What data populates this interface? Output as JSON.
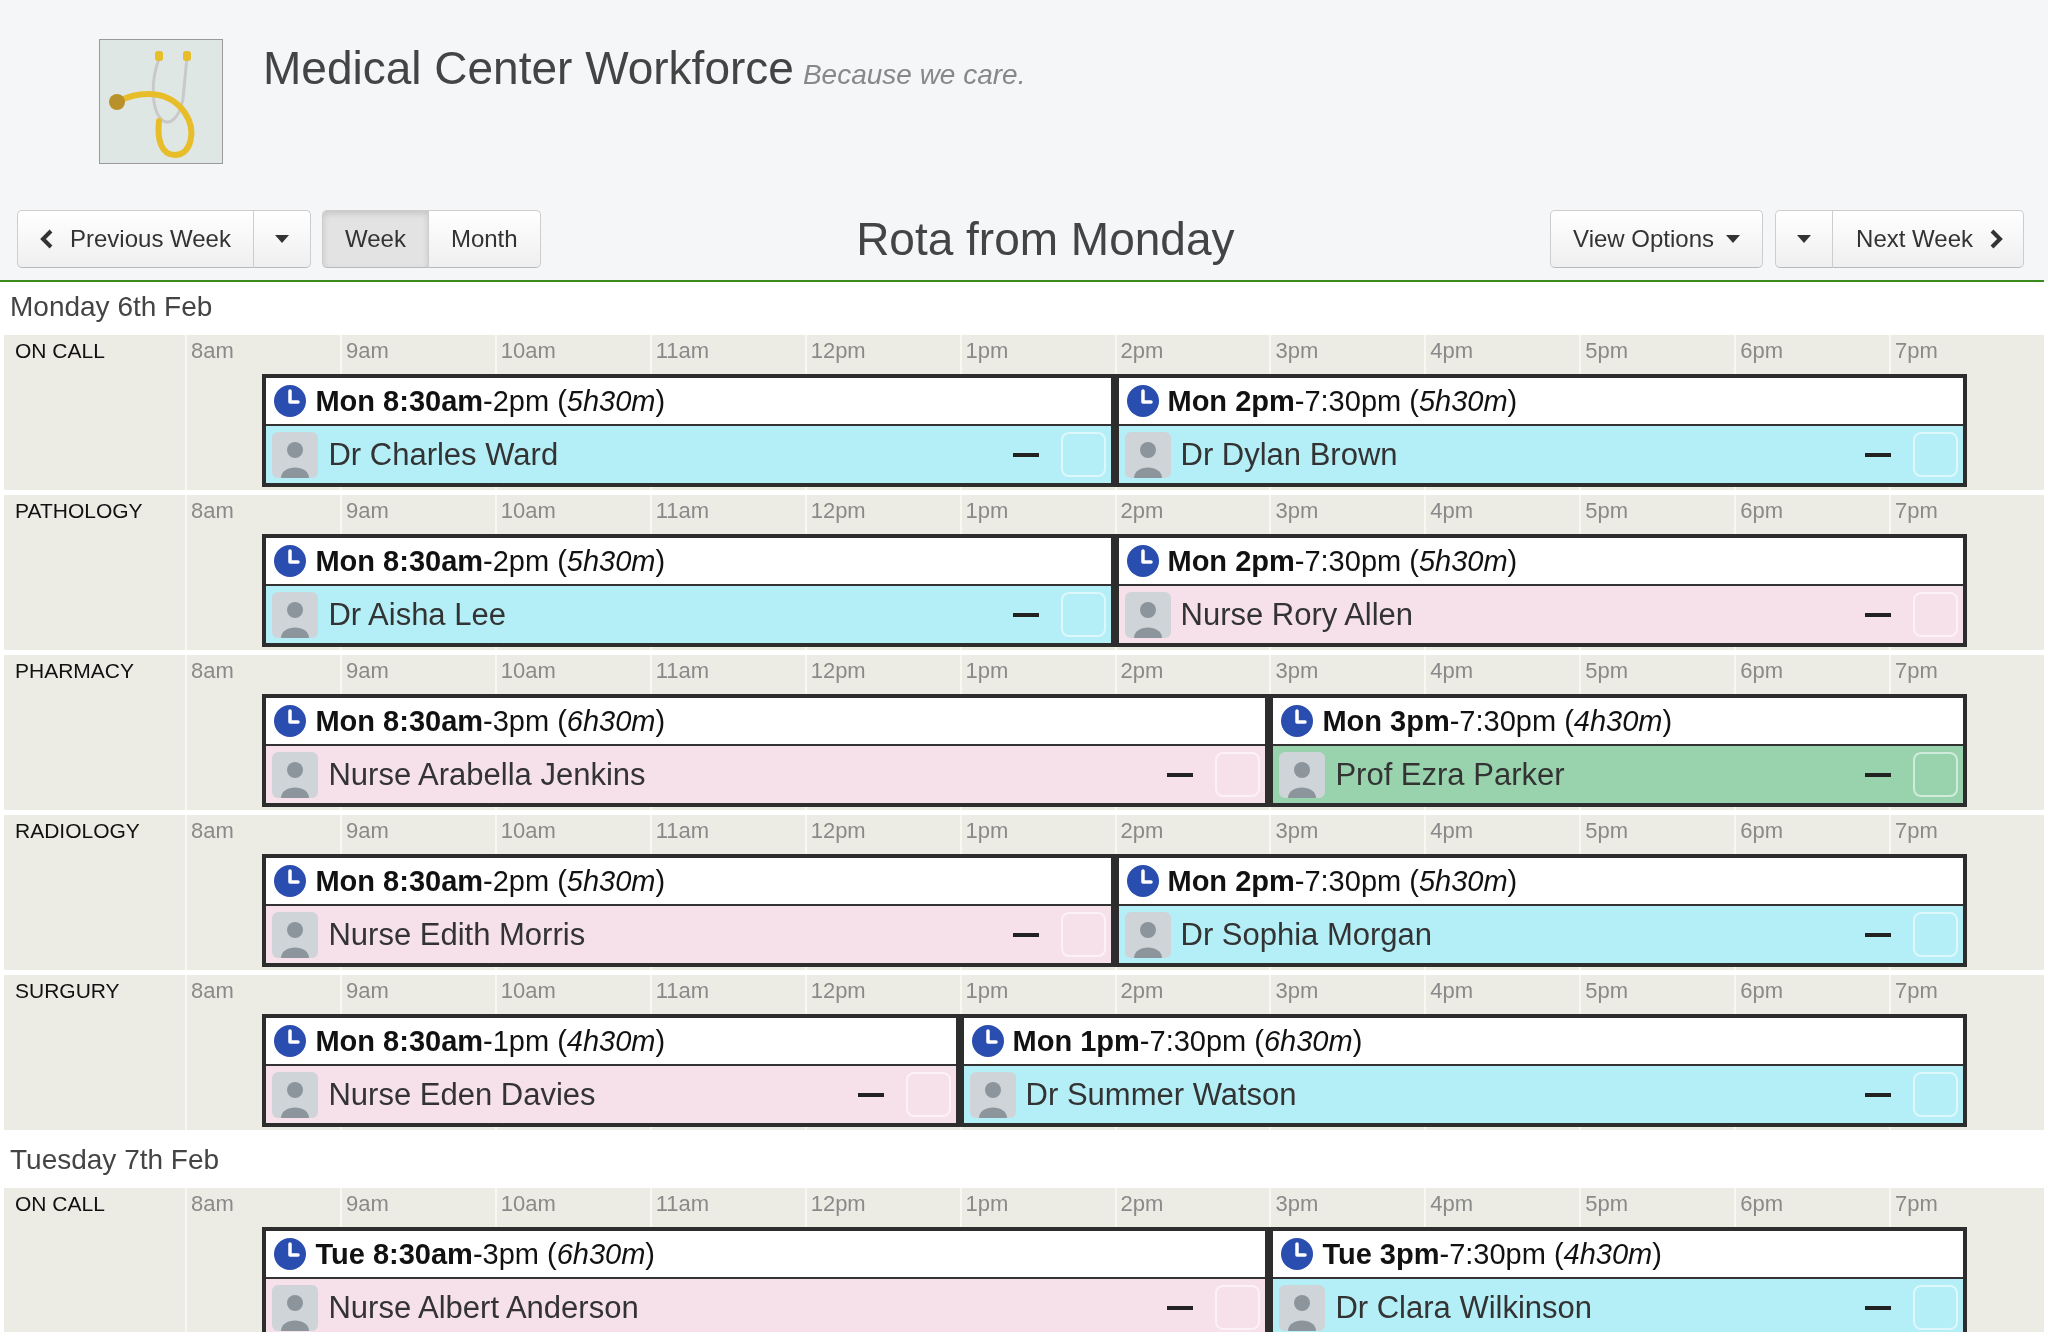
{
  "header": {
    "title": "Medical Center Workforce",
    "tagline": "Because we care."
  },
  "toolbar": {
    "previous_week": "Previous Week",
    "views": [
      {
        "label": "Week",
        "selected": true
      },
      {
        "label": "Month",
        "selected": false
      }
    ],
    "title": "Rota from Monday",
    "view_options": "View Options",
    "next_week": "Next Week"
  },
  "days": [
    {
      "heading": "Monday 6th Feb",
      "departments": [
        {
          "name": "ON CALL",
          "hours": [
            "8am",
            "9am",
            "10am",
            "11am",
            "12pm",
            "1pm",
            "2pm",
            "3pm",
            "4pm",
            "5pm",
            "6pm",
            "7pm"
          ],
          "shifts": [
            {
              "time": "**Mon 8:30am**-2pm (*5h30m*)",
              "staff": "Dr Charles Ward",
              "color": "#b4eef7",
              "checked": false
            },
            {
              "time": "**Mon 2pm**-7:30pm (*5h30m*)",
              "staff": "Dr Dylan Brown",
              "color": "#b4eef7",
              "checked": false
            }
          ]
        },
        {
          "name": "PATHOLOGY",
          "hours": [
            "8am",
            "9am",
            "10am",
            "11am",
            "12pm",
            "1pm",
            "2pm",
            "3pm",
            "4pm",
            "5pm",
            "6pm",
            "7pm"
          ],
          "shifts": [
            {
              "time": "**Mon 8:30am**-2pm (*5h30m*)",
              "staff": "Dr Aisha Lee",
              "color": "#b4eef7",
              "checked": false
            },
            {
              "time": "**Mon 2pm**-7:30pm (*5h30m*)",
              "staff": "Nurse Rory Allen",
              "color": "#f6e1ea",
              "checked": false
            }
          ]
        },
        {
          "name": "PHARMACY",
          "hours": [
            "8am",
            "9am",
            "10am",
            "11am",
            "12pm",
            "1pm",
            "2pm",
            "3pm",
            "4pm",
            "5pm",
            "6pm",
            "7pm"
          ],
          "shifts": [
            {
              "time": "**Mon 8:30am**-3pm (*6h30m*)",
              "staff": "Nurse Arabella Jenkins",
              "color": "#f6e1ea",
              "checked": false
            },
            {
              "time": "**Mon 3pm**-7:30pm (*4h30m*)",
              "staff": "Prof Ezra Parker",
              "color": "#99d3ae",
              "checked": false
            }
          ]
        },
        {
          "name": "RADIOLOGY",
          "hours": [
            "8am",
            "9am",
            "10am",
            "11am",
            "12pm",
            "1pm",
            "2pm",
            "3pm",
            "4pm",
            "5pm",
            "6pm",
            "7pm"
          ],
          "shifts": [
            {
              "time": "**Mon 8:30am**-2pm (*5h30m*)",
              "staff": "Nurse Edith Morris",
              "color": "#f6e1ea",
              "checked": false
            },
            {
              "time": "**Mon 2pm**-7:30pm (*5h30m*)",
              "staff": "Dr Sophia Morgan",
              "color": "#b4eef7",
              "checked": false
            }
          ]
        },
        {
          "name": "SURGURY",
          "hours": [
            "8am",
            "9am",
            "10am",
            "11am",
            "12pm",
            "1pm",
            "2pm",
            "3pm",
            "4pm",
            "5pm",
            "6pm",
            "7pm"
          ],
          "shifts": [
            {
              "time": "**Mon 8:30am**-1pm (*4h30m*)",
              "staff": "Nurse Eden Davies",
              "color": "#f6e1ea",
              "checked": false
            },
            {
              "time": "**Mon 1pm**-7:30pm (*6h30m*)",
              "staff": "Dr Summer Watson",
              "color": "#b4eef7",
              "checked": false
            }
          ]
        }
      ]
    },
    {
      "heading": "Tuesday 7th Feb",
      "departments": [
        {
          "name": "ON CALL",
          "hours": [
            "8am",
            "9am",
            "10am",
            "11am",
            "12pm",
            "1pm",
            "2pm",
            "3pm",
            "4pm",
            "5pm",
            "6pm",
            "7pm"
          ],
          "shifts": [
            {
              "time": "**Tue 8:30am**-3pm (*6h30m*)",
              "staff": "Nurse Albert Anderson",
              "color": "#f6e1ea",
              "checked": false
            },
            {
              "time": "**Tue 3pm**-7:30pm (*4h30m*)",
              "staff": "Dr Clara Wilkinson",
              "color": "#b4eef7",
              "checked": false
            }
          ]
        }
      ]
    }
  ]
}
